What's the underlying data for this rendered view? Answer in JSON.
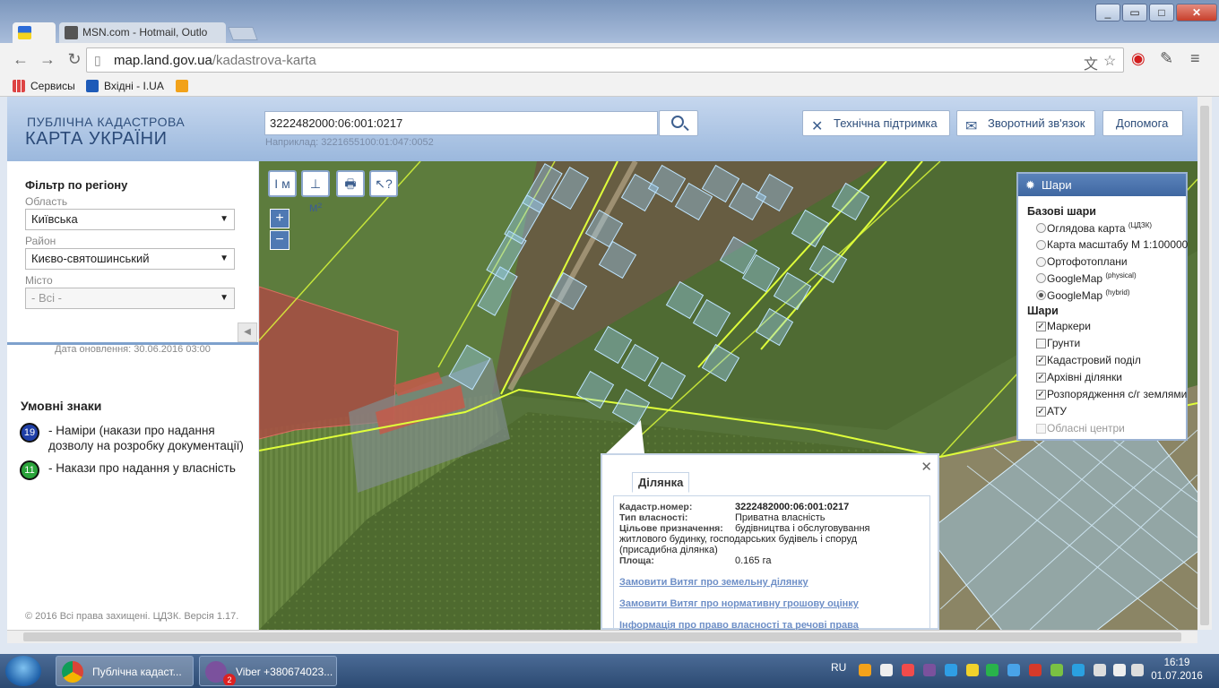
{
  "browser": {
    "tabs": [
      {
        "label": ""
      },
      {
        "label": "MSN.com - Hotmail, Outlo"
      }
    ],
    "url_host": "map.land.gov.ua",
    "url_path": "/kadastrova-karta",
    "bookmarks": [
      "Сервисы",
      "Вхідні - I.UA",
      ""
    ]
  },
  "header": {
    "logo_line1": "ПУБЛІЧНА КАДАСТРОВА",
    "logo_line2": "КАРТА УКРАЇНИ",
    "search_value": "3222482000:06:001:0217",
    "search_example": "Наприклад: 3221655100:01:047:0052",
    "buttons": [
      "Технічна підтримка",
      "Зворотний зв'язок",
      "Допомога"
    ]
  },
  "filter": {
    "title": "Фільтр по регіону",
    "oblast_label": "Область",
    "oblast_value": "Київська",
    "raion_label": "Район",
    "raion_value": "Києво-святошинський",
    "misto_label": "Місто",
    "misto_value": "- Всі -",
    "updated": "Дата оновлення: 30.06.2016 03:00"
  },
  "legend": {
    "title": "Умовні знаки",
    "items": [
      {
        "count": "19",
        "text": "- Наміри (накази про надання дозволу на розробку документації)",
        "color": "#1f3fa8"
      },
      {
        "count": "11",
        "text": "- Накази про надання у власність",
        "color": "#2aa33a"
      }
    ]
  },
  "copyright": "© 2016 Всі права захищені. ЦДЗК. Версія 1.17.",
  "layers": {
    "title": "Шари",
    "base_title": "Базові шари",
    "base": [
      {
        "label": "Оглядова карта",
        "sup": "(ЦДЗК)",
        "on": false
      },
      {
        "label": "Карта масштабу М 1:100000",
        "sup": "",
        "on": false
      },
      {
        "label": "Ортофотоплани",
        "sup": "",
        "on": false
      },
      {
        "label": "GoogleMap",
        "sup": "(physical)",
        "on": false
      },
      {
        "label": "GoogleMap",
        "sup": "(hybrid)",
        "on": true
      }
    ],
    "overlay_title": "Шари",
    "overlays": [
      {
        "label": "Маркери",
        "checked": true
      },
      {
        "label": "Грунти",
        "checked": false
      },
      {
        "label": "Кадастровий поділ",
        "checked": true
      },
      {
        "label": "Архівні ділянки",
        "checked": true
      },
      {
        "label": "Розпорядження с/г землями",
        "checked": true
      },
      {
        "label": "АТУ",
        "checked": true
      },
      {
        "label": "Обласні центри",
        "checked": false,
        "disabled": true
      }
    ]
  },
  "popup": {
    "tab": "Ділянка",
    "rows": [
      {
        "k": "Кадастр.номер:",
        "v": "3222482000:06:001:0217"
      },
      {
        "k": "Тип власності:",
        "v": "Приватна власність"
      },
      {
        "k": "Цільове призначення:",
        "v": "будівництва і обслуговування"
      },
      {
        "k": "",
        "v": "житлового будинку, господарських будівель і споруд (присадибна ділянка)"
      },
      {
        "k": "Площа:",
        "v": "0.165 га"
      }
    ],
    "links": [
      "Замовити Витяг про земельну ділянку",
      "Замовити Витяг про нормативну грошову оцінку",
      "Інформація про право власності та речові права"
    ]
  },
  "map_tools": [
    "I м",
    "⊥ м²",
    "🖶",
    "↖?"
  ],
  "taskbar": {
    "tasks": [
      "Публічна кадаст...",
      "Viber +380674023..."
    ],
    "viber_badge": "2",
    "lang": "RU",
    "time": "16:19",
    "date": "01.07.2016"
  },
  "colors": {
    "accent": "#3f67a1",
    "parcel_outline": "#9fd4ff",
    "boundary": "#e0ff3a",
    "selected_area": "#c0393b"
  }
}
